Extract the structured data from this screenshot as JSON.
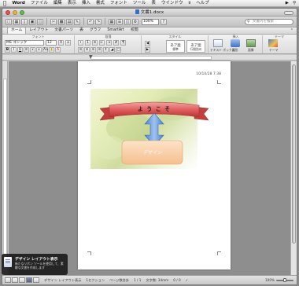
{
  "menubar": {
    "app": "Word",
    "items": [
      "ファイル",
      "編集",
      "表示",
      "挿入",
      "書式",
      "フォント",
      "ツール",
      "表",
      "ウインドウ",
      "ヘルプ"
    ],
    "extra_icon": "ʬ"
  },
  "window": {
    "title": "文書1.docx"
  },
  "toolbar": {
    "zoom": "100%",
    "search_placeholder": "文書内を検索"
  },
  "ribbon_tabs": [
    "ホーム",
    "レイアウト",
    "文書パーツ",
    "表",
    "グラフ",
    "SmartArt",
    "校閲"
  ],
  "ribbon": {
    "font_group": "フォント",
    "font_name": "MS ゴシック",
    "font_size": "12",
    "paragraph_group": "段落",
    "styles_group": "スタイル",
    "style_samples": [
      {
        "sample": "あア亜",
        "name": "標準"
      },
      {
        "sample": "あア亜",
        "name": "行間詰め"
      }
    ],
    "insert_group": "挿入",
    "themes_group": "テーマ",
    "text_box_label": "テキスト ボックス",
    "shape_label": "図形",
    "picture_label": "画像",
    "theme_label": "テーマ"
  },
  "document": {
    "date_text": "10/10/28 7:38",
    "banner_text": "よ う こ そ",
    "box_text": "デザイン"
  },
  "statusbar": {
    "view": "デザイン レイアウト表示",
    "section": "1セクション",
    "pages": "ページ数合計",
    "page_of": "1 / 1",
    "words": "文字数: 34mm",
    "count": "0 / 0",
    "zoom": "100%"
  },
  "notification": {
    "title": "デザイン レイアウト表示",
    "body": "新たなリボン ツールを使用して、素敵な文書を作成します"
  }
}
